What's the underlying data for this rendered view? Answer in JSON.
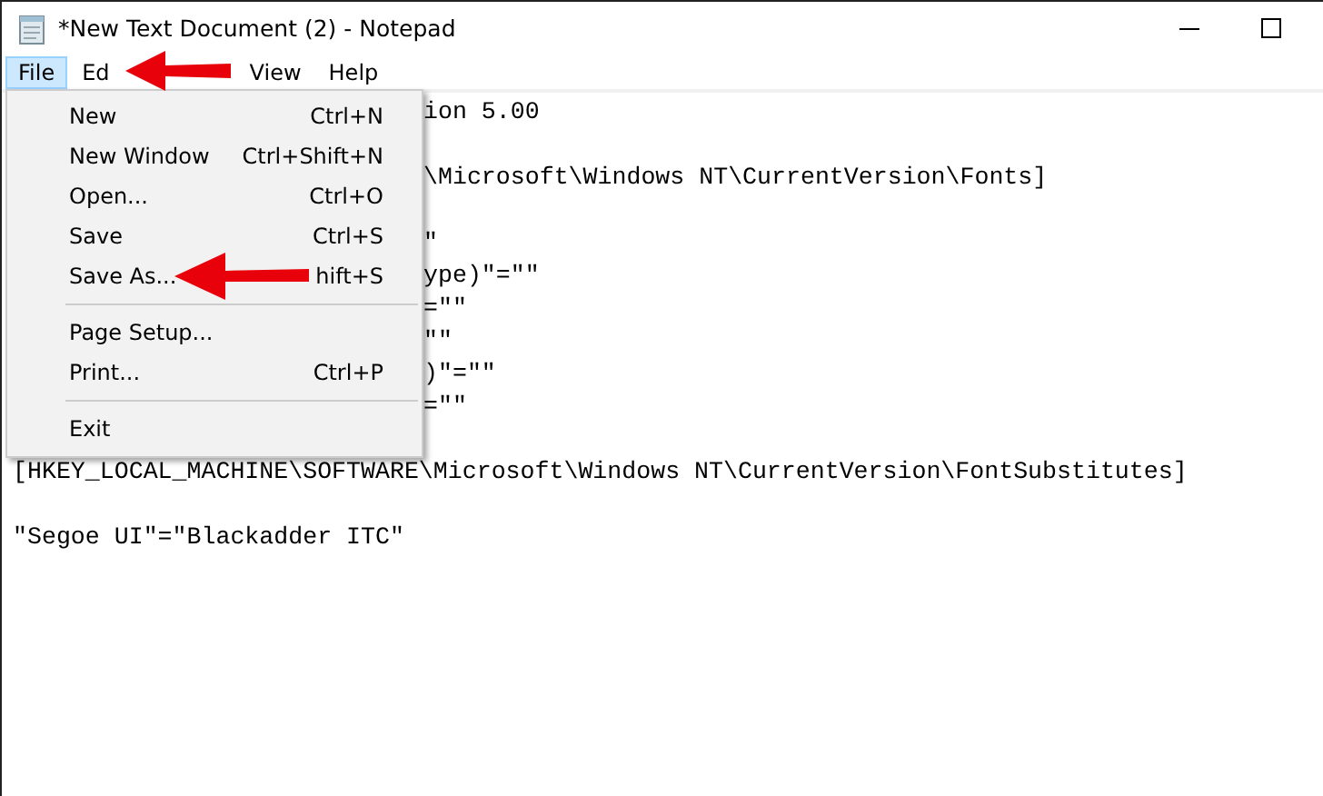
{
  "window": {
    "title": "*New Text Document (2) - Notepad"
  },
  "menubar": [
    {
      "label": "File",
      "selected": true,
      "kind": "item"
    },
    {
      "label": "Ed",
      "selected": false,
      "kind": "item"
    },
    {
      "kind": "covered"
    },
    {
      "label": "View",
      "selected": false,
      "kind": "item"
    },
    {
      "label": "Help",
      "selected": false,
      "kind": "item"
    }
  ],
  "file_menu": [
    {
      "kind": "item",
      "label": "New",
      "shortcut": "Ctrl+N"
    },
    {
      "kind": "item",
      "label": "New Window",
      "shortcut": "Ctrl+Shift+N"
    },
    {
      "kind": "item",
      "label": "Open...",
      "shortcut": "Ctrl+O"
    },
    {
      "kind": "item",
      "label": "Save",
      "shortcut": "Ctrl+S"
    },
    {
      "kind": "item",
      "label": "Save As...",
      "shortcut": "hift+S"
    },
    {
      "kind": "separator"
    },
    {
      "kind": "item",
      "label": "Page Setup..."
    },
    {
      "kind": "item",
      "label": "Print...",
      "shortcut": "Ctrl+P"
    },
    {
      "kind": "separator"
    },
    {
      "kind": "item",
      "label": "Exit"
    }
  ],
  "editor": {
    "lines": [
      {
        "kind": "partial",
        "text": "ion 5.00"
      },
      {
        "kind": "blank"
      },
      {
        "kind": "partial",
        "text": "\\Microsoft\\Windows NT\\CurrentVersion\\Fonts]"
      },
      {
        "kind": "blank"
      },
      {
        "kind": "partial",
        "text": "\""
      },
      {
        "kind": "partial",
        "text": "ype)\"=\"\""
      },
      {
        "kind": "partial",
        "text": "=\"\""
      },
      {
        "kind": "partial",
        "text": "\"\""
      },
      {
        "kind": "partial",
        "text": ")\"=\"\""
      },
      {
        "kind": "partial",
        "text": "=\"\""
      },
      {
        "kind": "blank"
      },
      {
        "kind": "full",
        "text": "[HKEY_LOCAL_MACHINE\\SOFTWARE\\Microsoft\\Windows NT\\CurrentVersion\\FontSubstitutes]"
      },
      {
        "kind": "blank"
      },
      {
        "kind": "full",
        "text": "\"Segoe UI\"=\"Blackadder ITC\""
      }
    ]
  }
}
